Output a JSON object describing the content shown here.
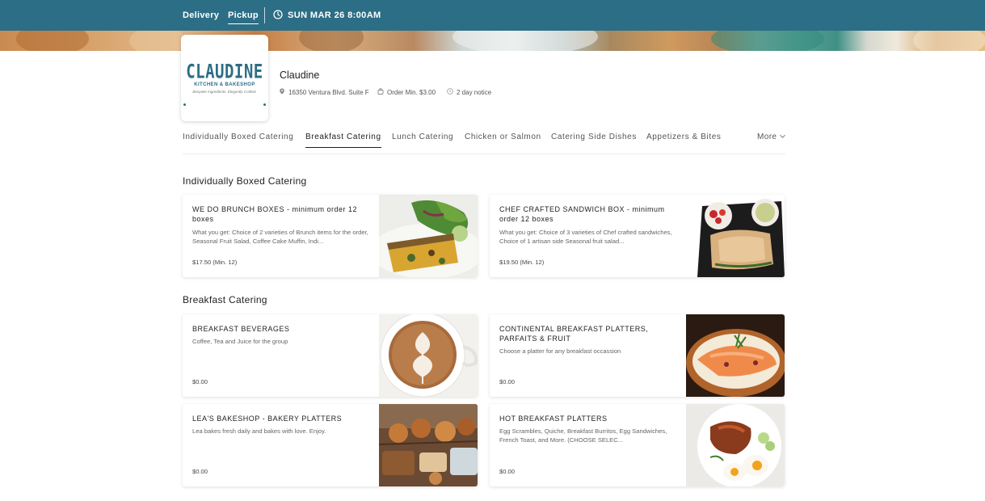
{
  "topbar": {
    "delivery_label": "Delivery",
    "pickup_label": "Pickup",
    "active_mode": "Pickup",
    "schedule_label": "SUN MAR 26 8:00AM",
    "bg_color": "#2c6e85"
  },
  "vendor": {
    "logo": {
      "word": "CLAUDINE",
      "sub": "KITCHEN & BAKESHOP",
      "tagline": "Bespoke Ingredients. Elegantly Crafted."
    },
    "name": "Claudine",
    "address": "16350 Ventura Blvd. Suite F",
    "order_min": "Order Min. $3.00",
    "notice": "2 day notice"
  },
  "tabs": {
    "items": [
      "Individually Boxed Catering",
      "Breakfast Catering",
      "Lunch Catering",
      "Chicken or Salmon",
      "Catering Side Dishes",
      "Appetizers & Bites"
    ],
    "active": "Breakfast Catering",
    "more_label": "More"
  },
  "sections": [
    {
      "title": "Individually Boxed Catering",
      "items": [
        {
          "name": "WE DO BRUNCH BOXES - minimum order 12 boxes",
          "description": "What you get: Choice of 2 varieties of Brunch items for the order, Seasonal Fruit Salad, Coffee Cake Muffin, Indi...",
          "price": "$17.50 (Min. 12)",
          "image": "quiche-salad"
        },
        {
          "name": "CHEF CRAFTED SANDWICH BOX - minimum order 12 boxes",
          "description": "What you get: Choice of 3 varieties of Chef crafted sandwiches, Choice of 1 artisan side Seasonal fruit salad...",
          "price": "$19.50 (Min. 12)",
          "image": "sandwich-box"
        }
      ]
    },
    {
      "title": "Breakfast Catering",
      "items": [
        {
          "name": "BREAKFAST BEVERAGES",
          "description": "Coffee, Tea and Juice for the group",
          "price": "$0.00",
          "image": "latte-art"
        },
        {
          "name": "CONTINENTAL BREAKFAST PLATTERS, PARFAITS & FRUIT",
          "description": "Choose a platter for any breakfast occassion",
          "price": "$0.00",
          "image": "salmon-bagel"
        },
        {
          "name": "LEA'S BAKESHOP - BAKERY PLATTERS",
          "description": "Lea bakes fresh daily and bakes with love. Enjoy.",
          "price": "$0.00",
          "image": "pastries"
        },
        {
          "name": "HOT BREAKFAST PLATTERS",
          "description": "Egg Scrambles, Quiche, Breakfast Burritos, Egg Sandwiches, French Toast, and More. (CHOOSE SELEC...",
          "price": "$0.00",
          "image": "eggs-plate"
        }
      ]
    }
  ]
}
